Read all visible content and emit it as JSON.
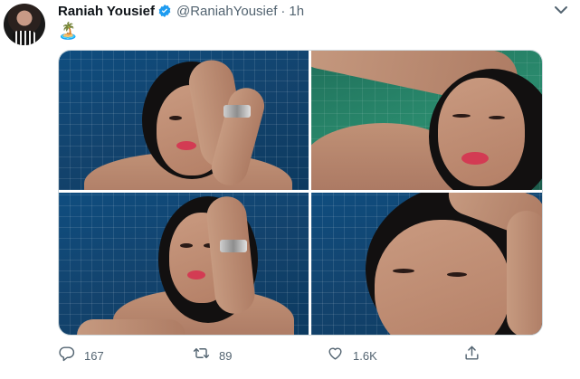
{
  "tweet": {
    "display_name": "Raniah Yousief",
    "handle": "@RaniahYousief",
    "separator": "·",
    "time": "1h",
    "body_emoji": "🏝️"
  },
  "stats": {
    "replies": "167",
    "retweets": "89",
    "likes": "1.6K"
  },
  "colors": {
    "verified": "#1d9bf0",
    "muted": "#536471"
  },
  "icons": [
    "verified-badge-icon",
    "more-options-icon",
    "reply-icon",
    "retweet-icon",
    "like-icon",
    "share-icon"
  ]
}
